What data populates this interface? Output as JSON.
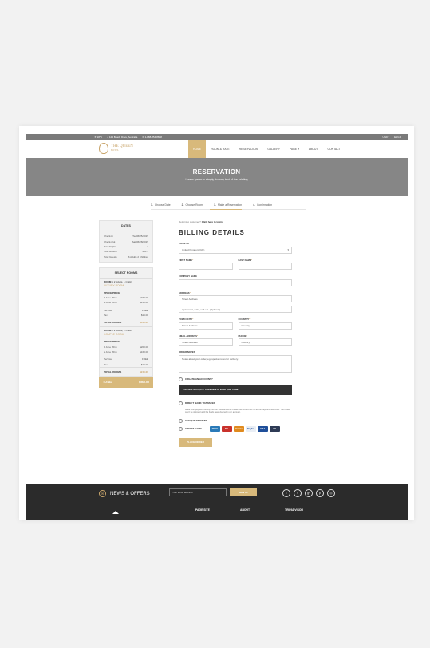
{
  "topbar": {
    "items_left": [
      "☀ 18°C",
      "⌂ 123 Beach Drive, Australia",
      "✆ 1-888-854-8888"
    ],
    "items_right": [
      "USD ▾",
      "ENG ▾"
    ]
  },
  "brand": {
    "name": "THE QUEEN",
    "sub": "HOTEL"
  },
  "nav": {
    "items": [
      "HOME",
      "ROOM & RATE",
      "RESERVATION",
      "GALLERY",
      "PAGE ▾",
      "ABOUT",
      "CONTACT"
    ]
  },
  "hero": {
    "title": "RESERVATION",
    "subtitle": "Lorem Ipsum is simply dummy text of the printing"
  },
  "steps": [
    {
      "num": "1.",
      "label": "Choose Date"
    },
    {
      "num": "2.",
      "label": "Choose Room"
    },
    {
      "num": "3.",
      "label": "Make a Reservation"
    },
    {
      "num": "4.",
      "label": "Confirmation"
    }
  ],
  "dates": {
    "title": "DATES",
    "rows": [
      {
        "k": "Check-In",
        "v": "Thu 06/25/2015"
      },
      {
        "k": "Check-Out",
        "v": "Sat 06/28/2015"
      },
      {
        "k": "Total Nights",
        "v": "3"
      },
      {
        "k": "Total Rooms",
        "v": "2 of 5"
      },
      {
        "k": "Total Guests",
        "v": "6 Adults 2 Children"
      }
    ]
  },
  "rooms": {
    "title": "SELECT ROOMS",
    "list": [
      {
        "header": "ROOM 1",
        "guests": "2 Adults, 1 Child",
        "name": "LUXURY ROOM",
        "space_price_label": "SPACE PRICE",
        "prices": [
          {
            "k": "1 June 2015",
            "v": "$150.00"
          },
          {
            "k": "2 June 2015",
            "v": "$150.00"
          }
        ],
        "extras": [
          {
            "k": "Service",
            "v": "FREE"
          },
          {
            "k": "Tax",
            "v": "$15.00"
          }
        ],
        "total_label": "TOTAL ROOM 1",
        "total": "$315.00"
      },
      {
        "header": "ROOM 2",
        "guests": "2 Adults, 1 Child",
        "name": "COUPLE ROOM",
        "space_price_label": "SPACE PRICE",
        "prices": [
          {
            "k": "1 June 2015",
            "v": "$200.00"
          },
          {
            "k": "2 June 2015",
            "v": "$160.00"
          }
        ],
        "extras": [
          {
            "k": "Service",
            "v": "FREE"
          },
          {
            "k": "Tax",
            "v": "$15.00"
          }
        ],
        "total_label": "TOTAL ROOM 1",
        "total": "$245.00"
      }
    ],
    "grand_label": "TOTAL",
    "grand_total": "$560.00"
  },
  "billing": {
    "returning_text": "Returning customer?",
    "login_link": "Click here to login",
    "title": "BILLING DETAILS",
    "country_label": "COUNTRY",
    "country_value": "United Kingdom (UK)",
    "first_name_label": "FIRST NAME",
    "last_name_label": "LAST NAME",
    "company_label": "COMPANY NAME",
    "address_label": "ADDRESS",
    "address_placeholder": "Street Address",
    "address2_placeholder": "Apartment, suite, unit etc. (Optional)",
    "town_label": "TOWN / CITY",
    "town_placeholder": "Street Address",
    "county_label": "COUNTRY",
    "county_placeholder": "Country",
    "email_label": "EMAIL ADDRESS",
    "email_placeholder": "Street Address",
    "phone_label": "PHONE",
    "phone_placeholder": "Country",
    "notes_label": "ORDER NOTES",
    "notes_placeholder": "Notes about your order, eg. special notes for delivery.",
    "create_account": "CREATE AN ACCOUNT?",
    "coupon_text": "You have a coupon?",
    "coupon_link": "Click here to enter your code",
    "bank_transfer": "DIRECT BANK TRANSFER",
    "bank_note": "Make your payment directly into our bank account. Please use your Order ID as the payment reference. Your order won't be shipped until the funds have cleared in our account.",
    "cheque": "CHEQUE PAYMENT",
    "credit_card": "CREDIT CARD",
    "cards": [
      "AMEX",
      "MC",
      "Maestro",
      "PayPal",
      "VISA",
      "CB"
    ],
    "place_order": "PLACE ORDER"
  },
  "footer": {
    "newsletter": "NEWS & OFFERS",
    "email_placeholder": "Your email address",
    "signup": "SIGN UP",
    "social": [
      "t",
      "f",
      "g+",
      "p",
      "◎"
    ],
    "columns": [
      "PAGE SITE",
      "ABOUT",
      "TRIPADVISOR"
    ]
  }
}
